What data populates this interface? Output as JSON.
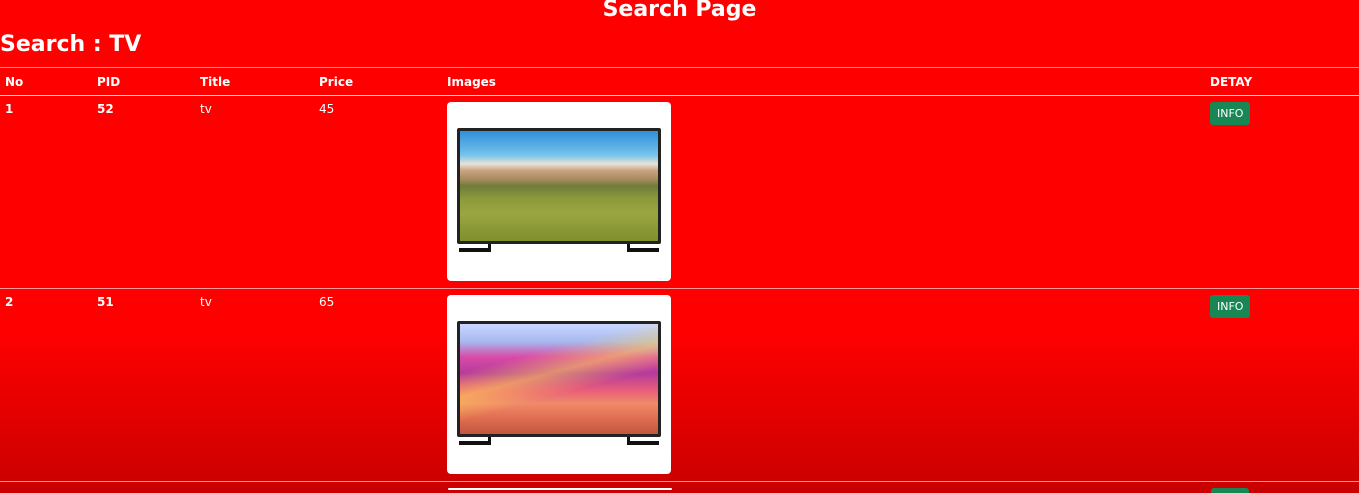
{
  "page": {
    "title": "Search Page",
    "search_heading": "Search : TV"
  },
  "table": {
    "headers": {
      "no": "No",
      "pid": "PID",
      "title": "Title",
      "price": "Price",
      "images": "Images",
      "detay": "DETAY"
    },
    "rows": [
      {
        "no": "1",
        "pid": "52",
        "title": "tv",
        "price": "45",
        "image": "tv-landscape-image",
        "action": "INFO"
      },
      {
        "no": "2",
        "pid": "51",
        "title": "tv",
        "price": "65",
        "image": "tv-mountains-image",
        "action": "INFO"
      }
    ]
  },
  "colors": {
    "background": "#ff0000",
    "button": "#198754",
    "text": "#ffffff"
  }
}
